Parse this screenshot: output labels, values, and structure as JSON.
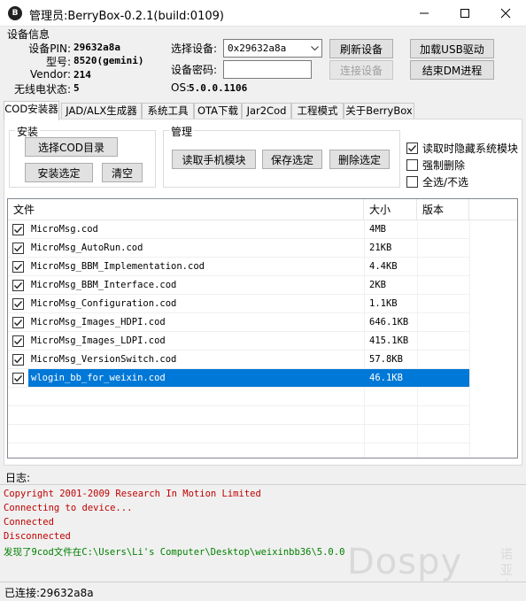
{
  "window": {
    "title": "管理员:BerryBox-0.2.1(build:0109)",
    "icon_glyph": "B"
  },
  "device_info": {
    "section_label": "设备信息",
    "pin_label": "设备PIN:",
    "pin_value": "29632a8a",
    "model_label": "型号:",
    "model_value": "8520(gemini)",
    "vendor_label": "Vendor:",
    "vendor_value": "214",
    "wireless_label": "无线电状态:",
    "wireless_value": "5",
    "select_device_label": "选择设备:",
    "select_device_value": "0x29632a8a",
    "device_password_label": "设备密码:",
    "device_password_value": "",
    "os_label": "OS:",
    "os_value": "5.0.0.1106"
  },
  "toolbar": {
    "refresh_label": "刷新设备",
    "connect_label": "连接设备",
    "load_usb_label": "加载USB驱动",
    "end_dm_label": "结束DM进程"
  },
  "tabs": [
    {
      "label": "COD安装器",
      "active": true
    },
    {
      "label": "JAD/ALX生成器",
      "active": false
    },
    {
      "label": "系统工具",
      "active": false
    },
    {
      "label": "OTA下载",
      "active": false
    },
    {
      "label": "Jar2Cod",
      "active": false
    },
    {
      "label": "工程模式",
      "active": false
    },
    {
      "label": "关于BerryBox",
      "active": false
    }
  ],
  "install_group": {
    "title": "安装",
    "select_dir_label": "选择COD目录",
    "install_selected_label": "安装选定",
    "clear_label": "清空"
  },
  "manage_group": {
    "title": "管理",
    "read_modules_label": "读取手机模块",
    "save_selected_label": "保存选定",
    "delete_selected_label": "删除选定"
  },
  "options": {
    "hide_system_label": "读取时隐藏系统模块",
    "hide_system_checked": true,
    "force_delete_label": "强制删除",
    "force_delete_checked": false,
    "select_all_label": "全选/不选",
    "select_all_checked": false
  },
  "file_list": {
    "columns": [
      "文件",
      "大小",
      "版本"
    ],
    "rows": [
      {
        "name": "MicroMsg.cod",
        "size": "4MB",
        "version": "",
        "checked": true,
        "selected": false
      },
      {
        "name": "MicroMsg_AutoRun.cod",
        "size": "21KB",
        "version": "",
        "checked": true,
        "selected": false
      },
      {
        "name": "MicroMsg_BBM_Implementation.cod",
        "size": "4.4KB",
        "version": "",
        "checked": true,
        "selected": false
      },
      {
        "name": "MicroMsg_BBM_Interface.cod",
        "size": "2KB",
        "version": "",
        "checked": true,
        "selected": false
      },
      {
        "name": "MicroMsg_Configuration.cod",
        "size": "1.1KB",
        "version": "",
        "checked": true,
        "selected": false
      },
      {
        "name": "MicroMsg_Images_HDPI.cod",
        "size": "646.1KB",
        "version": "",
        "checked": true,
        "selected": false
      },
      {
        "name": "MicroMsg_Images_LDPI.cod",
        "size": "415.1KB",
        "version": "",
        "checked": true,
        "selected": false
      },
      {
        "name": "MicroMsg_VersionSwitch.cod",
        "size": "57.8KB",
        "version": "",
        "checked": true,
        "selected": false
      },
      {
        "name": "wlogin_bb_for_weixin.cod",
        "size": "46.1KB",
        "version": "",
        "checked": true,
        "selected": true
      }
    ]
  },
  "log": {
    "label": "日志:",
    "lines": [
      {
        "text": "Copyright 2001-2009 Research In Motion Limited",
        "color": "#c00000"
      },
      {
        "text": "Connecting to device...",
        "color": "#c00000"
      },
      {
        "text": "Connected",
        "color": "#c00000"
      },
      {
        "text": "Disconnected",
        "color": "#c00000"
      },
      {
        "text": "发现了9cod文件在C:\\Users\\Li's Computer\\Desktop\\weixinbb36\\5.0.0",
        "color": "#008000"
      }
    ]
  },
  "watermark": {
    "text": "Dospy",
    "cn": "诺亚方舟"
  },
  "status": {
    "text": "已连接:29632a8a"
  },
  "colors": {
    "selection": "#0078d7",
    "log_error": "#c00000",
    "log_ok": "#008000"
  }
}
